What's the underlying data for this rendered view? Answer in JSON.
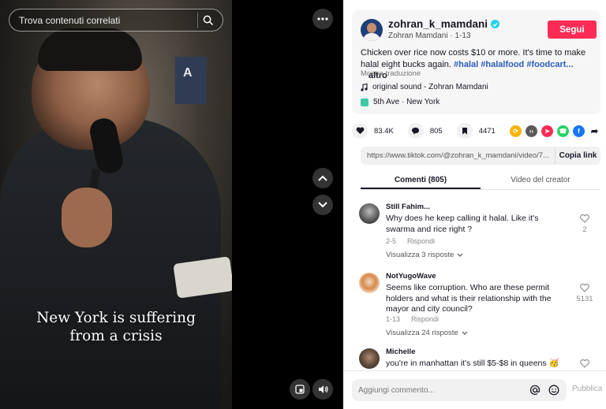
{
  "video": {
    "search_placeholder": "Trova contenuti correlati",
    "caption_line1": "New York is suffering",
    "caption_line2": "from a crisis",
    "sign_letter": "A"
  },
  "author": {
    "username": "zohran_k_mamdani",
    "display_name": "Zohran Mamdani",
    "date": "1-13",
    "follow_label": "Segui"
  },
  "post": {
    "description": "Chicken over rice now costs $10 or more. It's time to make halal eight bucks again.",
    "hashtags": "#halal #halalfood #foodcart...",
    "more_label": "altro",
    "translate_label": "Mostra traduzione",
    "sound": "original sound - Zohran Mamdani",
    "location": "5th Ave · New York"
  },
  "stats": {
    "likes": "83.4K",
    "comments": "805",
    "saves": "4471"
  },
  "link": {
    "url": "https://www.tiktok.com/@zohran_k_mamdani/video/7...",
    "copy_label": "Copia link"
  },
  "tabs": {
    "comments": "Comenti (805)",
    "creator_videos": "Video del creator"
  },
  "comments": [
    {
      "user": "Still Fahim...",
      "text": "Why does he keep calling it halal. Like it's swarma and rice right ?",
      "date": "2-5",
      "reply_label": "Rispondi",
      "replies_label": "Visualizza 3 risposte",
      "likes": "2"
    },
    {
      "user": "NotYugoWave",
      "text": "Seems like corruption. Who are these permit holders and what is their relationship with the mayor and city council?",
      "date": "1-13",
      "reply_label": "Rispondi",
      "replies_label": "Visualizza 24 risposte",
      "likes": "5131"
    },
    {
      "user": "Michelle",
      "text": "you're in manhattan it's still $5-$8 in queens 🥳",
      "likes": ""
    }
  ],
  "composer": {
    "placeholder": "Aggiungi commento...",
    "publish_label": "Pubblica"
  },
  "colors": {
    "follow": "#fe2c55",
    "hashtag": "#2b5db9",
    "verified": "#20d5ec"
  }
}
